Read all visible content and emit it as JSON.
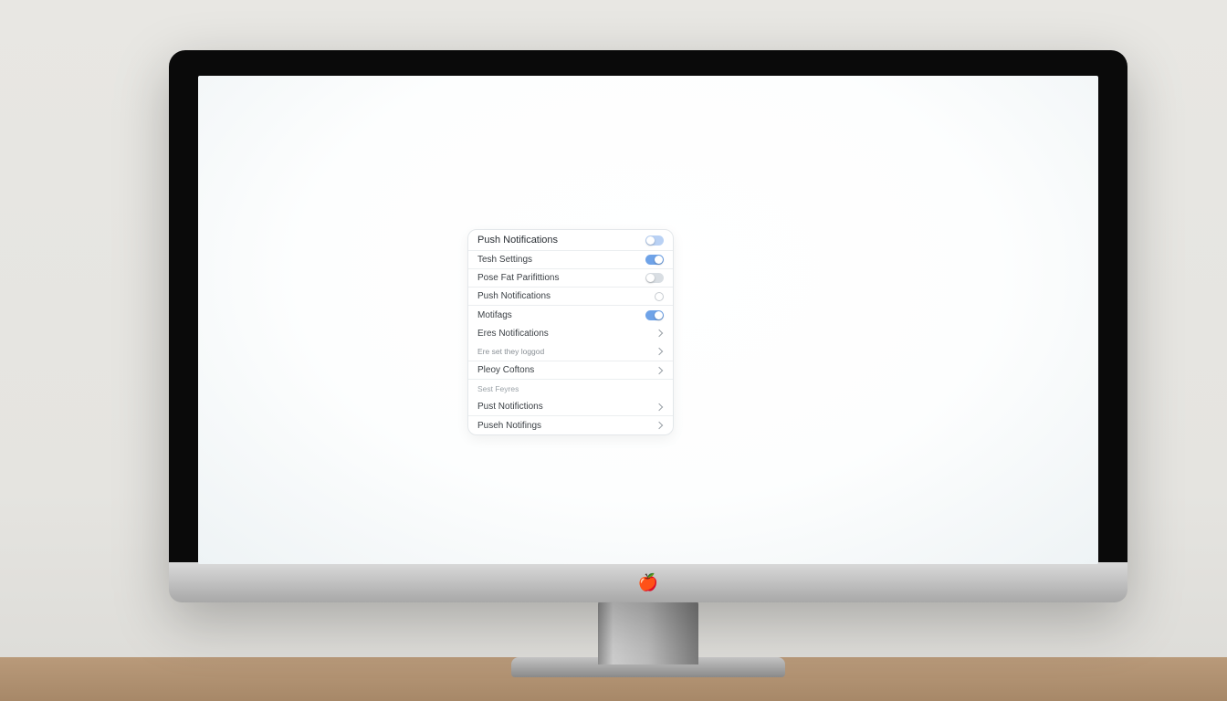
{
  "rows": [
    {
      "label": "Push Notifications",
      "control": "toggle",
      "state": "on-left",
      "style": "header"
    },
    {
      "label": "Tesh Settings",
      "control": "toggle",
      "state": "on",
      "style": "sub"
    },
    {
      "label": "Pose Fat Parifittions",
      "control": "toggle",
      "state": "off",
      "style": "sub"
    },
    {
      "label": "Push Notifications",
      "control": "circle",
      "state": "",
      "style": "sub"
    },
    {
      "label": "Motifags",
      "control": "toggle",
      "state": "on",
      "style": "sub nobd"
    },
    {
      "label": "Eres Notifications",
      "control": "chevron",
      "state": "",
      "style": "sub nobd"
    },
    {
      "label": "Ere set they loggod",
      "control": "chevron",
      "state": "",
      "style": "tiny"
    },
    {
      "label": "Pleoy Coftons",
      "control": "chevron",
      "state": "",
      "style": "sub"
    },
    {
      "label": "Sest Feyres",
      "control": "none",
      "state": "",
      "style": "section nobd"
    },
    {
      "label": "Pust Notifictions",
      "control": "chevron",
      "state": "",
      "style": "sub"
    },
    {
      "label": "Puseh Notifings",
      "control": "chevron",
      "state": "",
      "style": "sub"
    }
  ],
  "chin_label": "🍎"
}
